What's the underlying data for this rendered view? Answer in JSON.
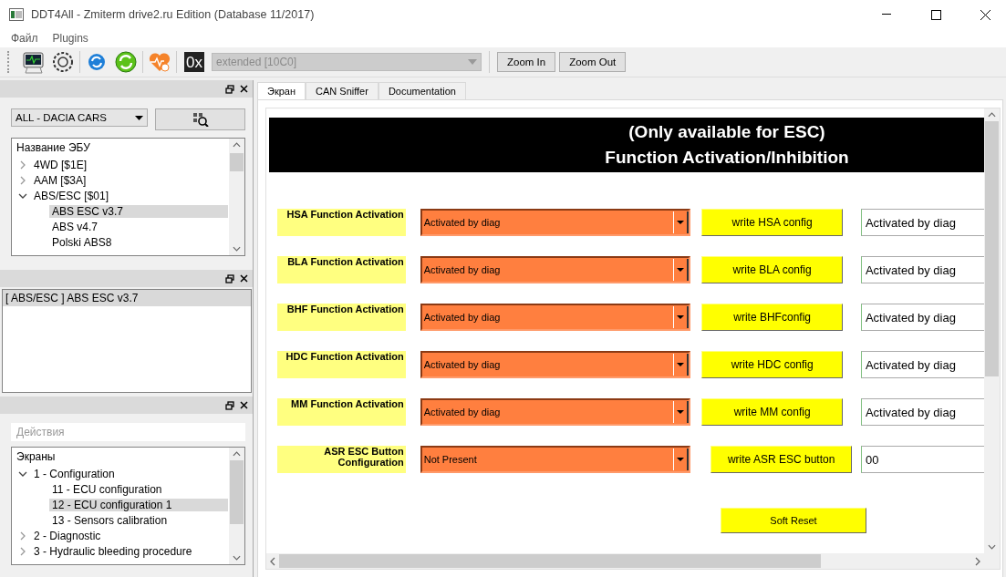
{
  "window": {
    "title": "DDT4All - Zmiterm drive2.ru Edition (Database 11/2017)"
  },
  "menu": [
    "Файл",
    "Plugins"
  ],
  "toolbar": {
    "hex_label": "0x",
    "mode_select": {
      "value": "extended [10C0]",
      "disabled": true
    },
    "buttons": [
      "Zoom In",
      "Zoom Out"
    ]
  },
  "ecu_panel": {
    "vehicle_select": {
      "value": "ALL - DACIA CARS"
    },
    "tree": {
      "header": "Название ЭБУ",
      "items": [
        {
          "label": "4WD [$1E]",
          "expanded": false,
          "selected": false
        },
        {
          "label": "AAM [$3A]",
          "expanded": false,
          "selected": false
        },
        {
          "label": "ABS/ESC [$01]",
          "expanded": true,
          "selected": false,
          "children": [
            {
              "label": "ABS ESC v3.7",
              "selected": true
            },
            {
              "label": "ABS v4.7",
              "selected": false
            },
            {
              "label": "Polski ABS8",
              "selected": false
            }
          ]
        }
      ]
    }
  },
  "selected_ecu_panel": {
    "items": [
      {
        "label": "[ ABS/ESC ] ABS ESC v3.7",
        "selected": true
      }
    ]
  },
  "screens_panel": {
    "filter": {
      "placeholder": "Действия"
    },
    "tree": {
      "header": "Экраны",
      "items": [
        {
          "label": "1 - Configuration",
          "expanded": true,
          "selected": false,
          "children": [
            {
              "label": "11 - ECU configuration",
              "selected": false
            },
            {
              "label": "12 - ECU configuration 1",
              "selected": true
            },
            {
              "label": "13 - Sensors calibration",
              "selected": false
            }
          ]
        },
        {
          "label": "2 - Diagnostic",
          "expanded": false,
          "selected": false
        },
        {
          "label": "3 - Hydraulic bleeding procedure",
          "expanded": false,
          "selected": false
        }
      ]
    }
  },
  "tabs": [
    {
      "label": "Экран",
      "selected": true
    },
    {
      "label": "CAN Sniffer",
      "selected": false
    },
    {
      "label": "Documentation",
      "selected": false
    }
  ],
  "form": {
    "header": [
      "(Only available for ESC)",
      "Function Activation/Inhibition"
    ],
    "rows": [
      {
        "label": "HSA Function Activation",
        "value": "Activated by diag",
        "button": "write HSA config",
        "readback": "Activated by diag"
      },
      {
        "label": "BLA Function Activation",
        "value": "Activated by diag",
        "button": "write BLA config",
        "readback": "Activated by diag"
      },
      {
        "label": "BHF Function Activation",
        "value": "Activated by diag",
        "button": "write BHFconfig",
        "readback": "Activated by diag"
      },
      {
        "label": "HDC Function Activation",
        "value": "Activated by diag",
        "button": "write HDC config",
        "readback": "Activated by diag"
      },
      {
        "label": "MM Function Activation",
        "value": "Activated by diag",
        "button": "write MM config",
        "readback": "Activated by diag"
      },
      {
        "label": "ASR ESC Button Configuration",
        "value": "Not Present",
        "button": "write ASR ESC button",
        "readback": "00"
      }
    ],
    "reset_button": "Soft Reset"
  }
}
